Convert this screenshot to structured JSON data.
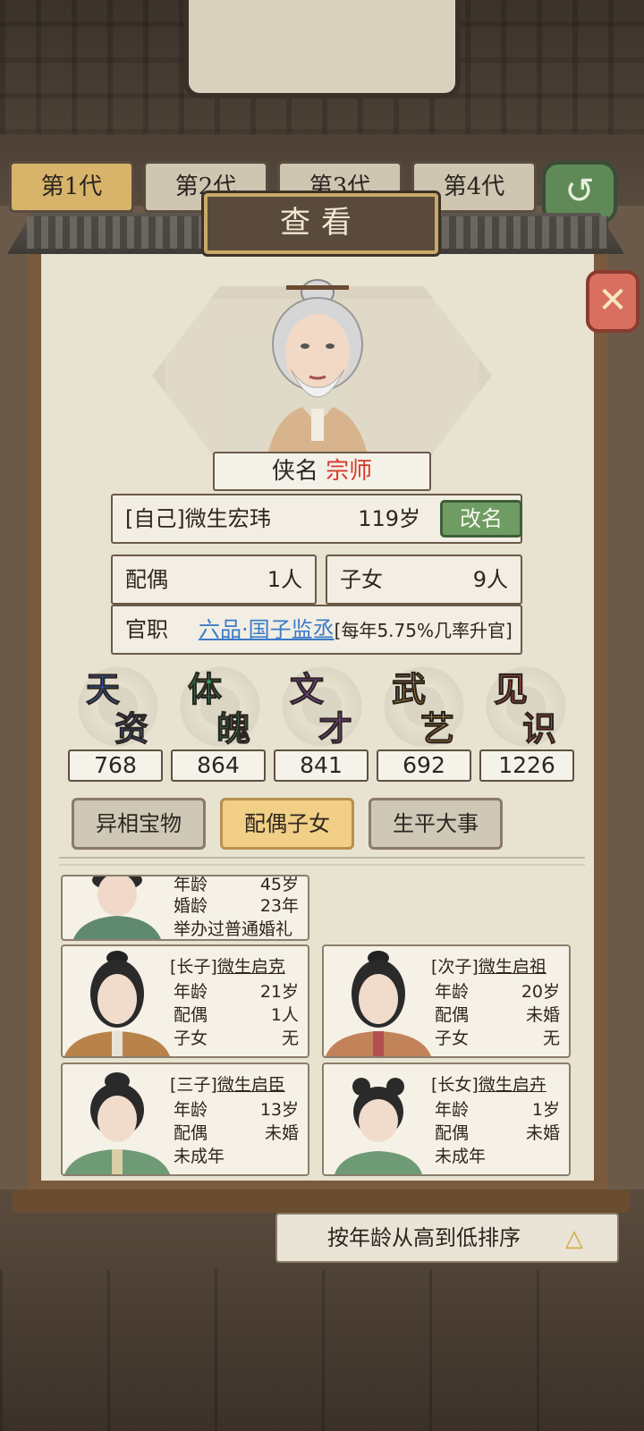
{
  "gen_tabs": [
    "第1代",
    "第2代",
    "第3代",
    "第4代"
  ],
  "modal": {
    "title": "查看",
    "close_icon": "close-icon"
  },
  "person": {
    "title_label": "侠名",
    "title_rank": "宗师",
    "name": "[自己]微生宏玮",
    "age": "119岁",
    "rename": "改名",
    "spouse_label": "配偶",
    "spouse_value": "1人",
    "children_label": "子女",
    "children_value": "9人",
    "official_label": "官职",
    "official_value": "六品·国子监丞",
    "official_note": "[每年5.75%几率升官]"
  },
  "attributes": [
    {
      "c1": "天",
      "c2": "资",
      "value": "768",
      "color": "#3b6fd4"
    },
    {
      "c1": "体",
      "c2": "魄",
      "value": "864",
      "color": "#3aa56a"
    },
    {
      "c1": "文",
      "c2": "才",
      "value": "841",
      "color": "#9a4fc9"
    },
    {
      "c1": "武",
      "c2": "艺",
      "value": "692",
      "color": "#e0a12a"
    },
    {
      "c1": "见",
      "c2": "识",
      "value": "1226",
      "color": "#d8524a"
    }
  ],
  "tabs": [
    "异相宝物",
    "配偶子女",
    "生平大事"
  ],
  "spouse_card": {
    "r1k": "年龄",
    "r1v": "45岁",
    "r2k": "婚龄",
    "r2v": "23年",
    "r3": "举办过普通婚礼"
  },
  "children": [
    {
      "tag": "[长子]",
      "name": "微生启克",
      "r1k": "年龄",
      "r1v": "21岁",
      "r2k": "配偶",
      "r2v": "1人",
      "r3k": "子女",
      "r3v": "无"
    },
    {
      "tag": "[次子]",
      "name": "微生启祖",
      "r1k": "年龄",
      "r1v": "20岁",
      "r2k": "配偶",
      "r2v": "未婚",
      "r3k": "子女",
      "r3v": "无"
    },
    {
      "tag": "[三子]",
      "name": "微生启臣",
      "r1k": "年龄",
      "r1v": "13岁",
      "r2k": "配偶",
      "r2v": "未婚",
      "r3k": "未成年",
      "r3v": ""
    },
    {
      "tag": "[长女]",
      "name": "微生启卉",
      "r1k": "年龄",
      "r1v": "1岁",
      "r2k": "配偶",
      "r2v": "未婚",
      "r3k": "未成年",
      "r3v": ""
    }
  ],
  "sort_label": "按年龄从高到低排序",
  "sort_icon": "triangle-up-icon"
}
